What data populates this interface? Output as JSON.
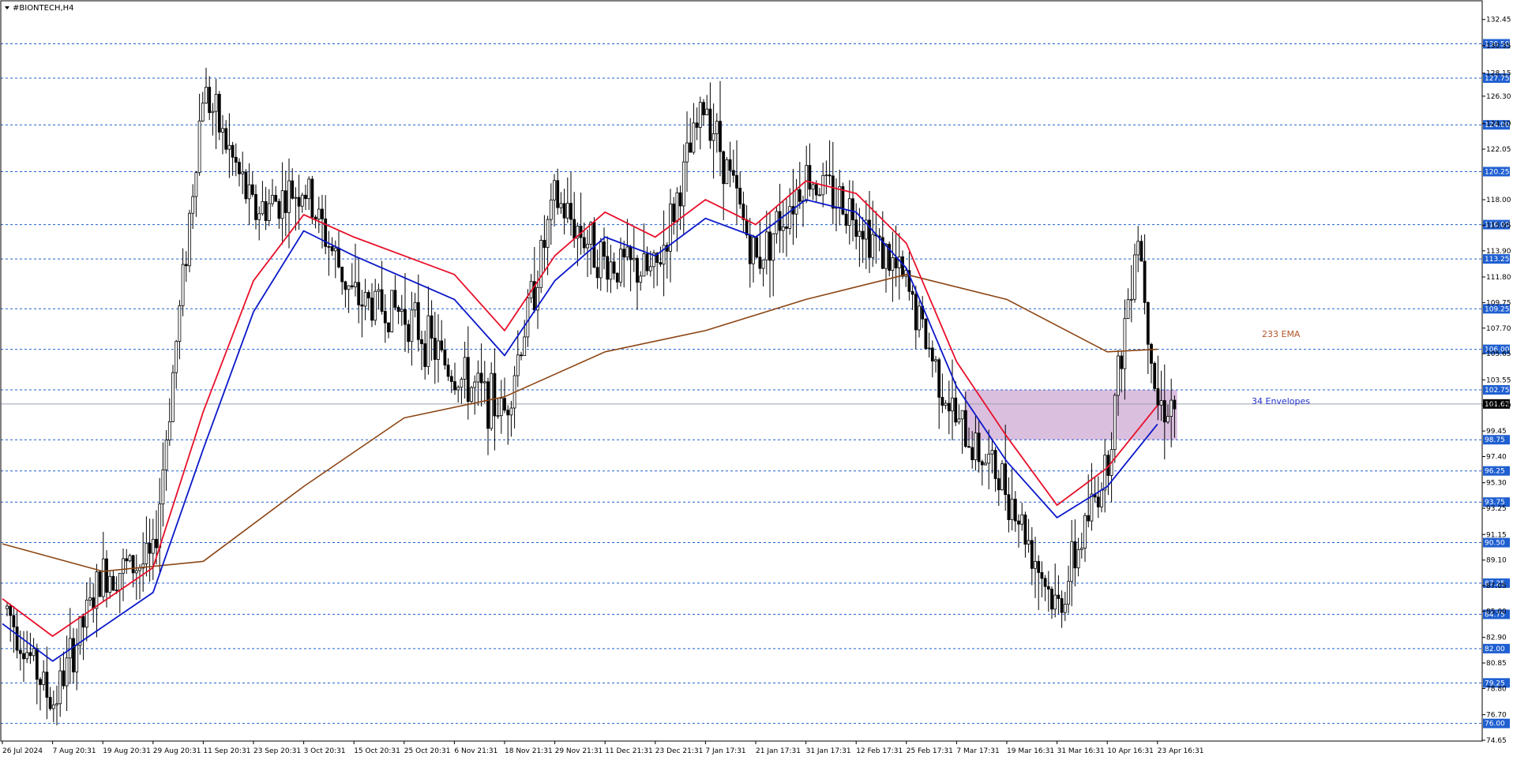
{
  "window": {
    "title": "#BIONTECH,H4",
    "menu_icon": "triangle-down-icon"
  },
  "colors": {
    "background": "#ffffff",
    "candle": "#000000",
    "level_line": "#1f5fd1",
    "level_badge": "#1f5fd1",
    "current_badge": "#000000",
    "envelope_upper": "#e8102a",
    "envelope_lower": "#0a18c8",
    "ema_233": "#8b4513",
    "zone_fill": "#cfaad4"
  },
  "annotations": {
    "ema_label": "233 EMA",
    "envelope_label": "34 Envelopes"
  },
  "chart_data": {
    "type": "candlestick",
    "symbol": "#BIONTECH",
    "timeframe": "H4",
    "ylim": [
      74.65,
      133.0
    ],
    "y_ticks": [
      "132.45",
      "130.35",
      "128.15",
      "126.30",
      "124.10",
      "122.05",
      "118.00",
      "115.95",
      "113.90",
      "111.80",
      "109.75",
      "107.70",
      "105.65",
      "103.55",
      "101.50",
      "99.45",
      "97.40",
      "95.30",
      "93.25",
      "91.15",
      "89.10",
      "87.05",
      "85.00",
      "82.90",
      "80.85",
      "78.80",
      "76.70",
      "74.65"
    ],
    "x_ticks": [
      "26 Jul 2024",
      "7 Aug 20:31",
      "19 Aug 20:31",
      "29 Aug 20:31",
      "11 Sep 20:31",
      "23 Sep 20:31",
      "3 Oct 20:31",
      "15 Oct 20:31",
      "25 Oct 20:31",
      "6 Nov 21:31",
      "18 Nov 21:31",
      "29 Nov 21:31",
      "11 Dec 21:31",
      "23 Dec 21:31",
      "7 Jan 17:31",
      "21 Jan 17:31",
      "31 Jan 17:31",
      "12 Feb 17:31",
      "25 Feb 17:31",
      "7 Mar 17:31",
      "19 Mar 16:31",
      "31 Mar 16:31",
      "10 Apr 16:31",
      "23 Apr 16:31"
    ],
    "levels": [
      "130.50",
      "127.75",
      "124.00",
      "120.25",
      "116.00",
      "113.25",
      "109.25",
      "106.00",
      "102.75",
      "98.75",
      "96.25",
      "93.75",
      "90.50",
      "87.25",
      "84.75",
      "82.00",
      "79.25",
      "76.00"
    ],
    "current_price": "101.62",
    "zone": {
      "x_start": "7 Mar 17:31",
      "x_end": "23 Apr 16:31",
      "y_low": 98.75,
      "y_high": 102.75
    },
    "key_prices": [
      {
        "x": "26 Jul 2024",
        "y": 86
      },
      {
        "x": "7 Aug 20:31",
        "y": 77.5
      },
      {
        "x": "19 Aug 20:31",
        "y": 88
      },
      {
        "x": "29 Aug 20:31",
        "y": 89
      },
      {
        "x": "11 Sep 20:31",
        "y": 127
      },
      {
        "x": "23 Sep 20:31",
        "y": 117
      },
      {
        "x": "3 Oct 20:31",
        "y": 119
      },
      {
        "x": "15 Oct 20:31",
        "y": 110
      },
      {
        "x": "25 Oct 20:31",
        "y": 109
      },
      {
        "x": "6 Nov 21:31",
        "y": 104
      },
      {
        "x": "18 Nov 21:31",
        "y": 101
      },
      {
        "x": "29 Nov 21:31",
        "y": 118
      },
      {
        "x": "11 Dec 21:31",
        "y": 113
      },
      {
        "x": "23 Dec 21:31",
        "y": 112
      },
      {
        "x": "7 Jan 17:31",
        "y": 126
      },
      {
        "x": "21 Jan 17:31",
        "y": 113
      },
      {
        "x": "31 Jan 17:31",
        "y": 120
      },
      {
        "x": "12 Feb 17:31",
        "y": 117
      },
      {
        "x": "25 Feb 17:31",
        "y": 111
      },
      {
        "x": "7 Mar 17:31",
        "y": 100
      },
      {
        "x": "19 Mar 16:31",
        "y": 95
      },
      {
        "x": "31 Mar 16:31",
        "y": 85
      },
      {
        "x": "10 Apr 16:31",
        "y": 97
      },
      {
        "x": "18 Apr 20:31",
        "y": 116
      },
      {
        "x": "23 Apr 16:31",
        "y": 101.62
      }
    ],
    "ema_233": [
      {
        "x": "26 Jul 2024",
        "y": 90.4
      },
      {
        "x": "19 Aug 20:31",
        "y": 88.2
      },
      {
        "x": "11 Sep 20:31",
        "y": 89.0
      },
      {
        "x": "3 Oct 20:31",
        "y": 95.0
      },
      {
        "x": "25 Oct 20:31",
        "y": 100.5
      },
      {
        "x": "18 Nov 21:31",
        "y": 102.2
      },
      {
        "x": "11 Dec 21:31",
        "y": 105.8
      },
      {
        "x": "7 Jan 17:31",
        "y": 107.5
      },
      {
        "x": "31 Jan 17:31",
        "y": 110.0
      },
      {
        "x": "25 Feb 17:31",
        "y": 112.0
      },
      {
        "x": "19 Mar 16:31",
        "y": 110.0
      },
      {
        "x": "10 Apr 16:31",
        "y": 105.8
      },
      {
        "x": "23 Apr 16:31",
        "y": 106.0
      }
    ],
    "envelope_upper": [
      {
        "x": "26 Jul 2024",
        "y": 86.0
      },
      {
        "x": "7 Aug 20:31",
        "y": 83.0
      },
      {
        "x": "29 Aug 20:31",
        "y": 88.5
      },
      {
        "x": "11 Sep 20:31",
        "y": 101.0
      },
      {
        "x": "23 Sep 20:31",
        "y": 111.5
      },
      {
        "x": "3 Oct 20:31",
        "y": 116.8
      },
      {
        "x": "15 Oct 20:31",
        "y": 115.0
      },
      {
        "x": "6 Nov 21:31",
        "y": 112.0
      },
      {
        "x": "18 Nov 21:31",
        "y": 107.5
      },
      {
        "x": "29 Nov 21:31",
        "y": 113.5
      },
      {
        "x": "11 Dec 21:31",
        "y": 117.0
      },
      {
        "x": "23 Dec 21:31",
        "y": 115.0
      },
      {
        "x": "7 Jan 17:31",
        "y": 118.0
      },
      {
        "x": "21 Jan 17:31",
        "y": 116.0
      },
      {
        "x": "31 Jan 17:31",
        "y": 119.5
      },
      {
        "x": "12 Feb 17:31",
        "y": 118.5
      },
      {
        "x": "25 Feb 17:31",
        "y": 114.5
      },
      {
        "x": "7 Mar 17:31",
        "y": 105.0
      },
      {
        "x": "19 Mar 16:31",
        "y": 99.0
      },
      {
        "x": "31 Mar 16:31",
        "y": 93.5
      },
      {
        "x": "10 Apr 16:31",
        "y": 96.5
      },
      {
        "x": "23 Apr 16:31",
        "y": 101.5
      }
    ],
    "envelope_lower": [
      {
        "x": "26 Jul 2024",
        "y": 84.0
      },
      {
        "x": "7 Aug 20:31",
        "y": 81.0
      },
      {
        "x": "29 Aug 20:31",
        "y": 86.5
      },
      {
        "x": "11 Sep 20:31",
        "y": 98.0
      },
      {
        "x": "23 Sep 20:31",
        "y": 109.0
      },
      {
        "x": "3 Oct 20:31",
        "y": 115.5
      },
      {
        "x": "15 Oct 20:31",
        "y": 113.5
      },
      {
        "x": "6 Nov 21:31",
        "y": 110.0
      },
      {
        "x": "18 Nov 21:31",
        "y": 105.5
      },
      {
        "x": "29 Nov 21:31",
        "y": 111.5
      },
      {
        "x": "11 Dec 21:31",
        "y": 115.0
      },
      {
        "x": "23 Dec 21:31",
        "y": 113.5
      },
      {
        "x": "7 Jan 17:31",
        "y": 116.5
      },
      {
        "x": "21 Jan 17:31",
        "y": 115.0
      },
      {
        "x": "31 Jan 17:31",
        "y": 118.0
      },
      {
        "x": "12 Feb 17:31",
        "y": 117.0
      },
      {
        "x": "25 Feb 17:31",
        "y": 112.5
      },
      {
        "x": "7 Mar 17:31",
        "y": 103.0
      },
      {
        "x": "19 Mar 16:31",
        "y": 97.0
      },
      {
        "x": "31 Mar 16:31",
        "y": 92.5
      },
      {
        "x": "10 Apr 16:31",
        "y": 95.0
      },
      {
        "x": "23 Apr 16:31",
        "y": 100.0
      }
    ]
  }
}
